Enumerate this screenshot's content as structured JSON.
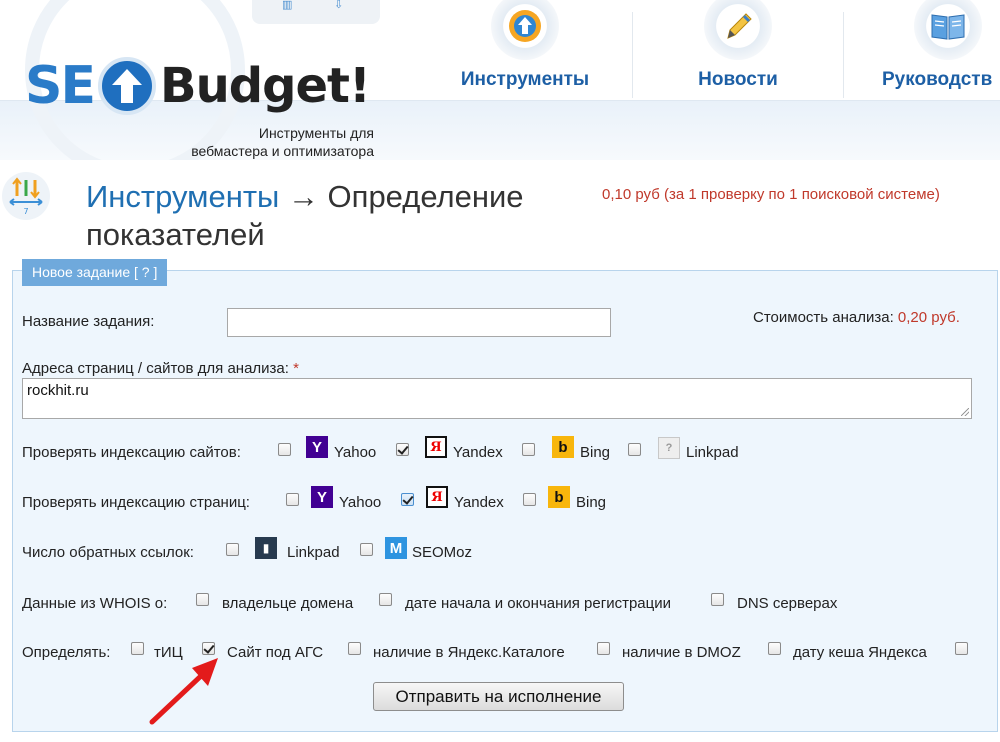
{
  "header": {
    "logo": {
      "se": "SE",
      "budget": "Budget!"
    },
    "tagline_line1": "Инструменты для",
    "tagline_line2": "вебмастера и оптимизатора",
    "nav": [
      {
        "label": "Инструменты",
        "icon": "upload-target-icon"
      },
      {
        "label": "Новости",
        "icon": "pencil-icon"
      },
      {
        "label": "Руководств",
        "icon": "book-icon"
      }
    ]
  },
  "page": {
    "title_link": "Инструменты",
    "title_arrow": "→",
    "title_rest": "Определение показателей",
    "price_note": "0,10 руб (за 1 проверку по 1 поисковой системе)"
  },
  "form": {
    "tab_label": "Новое задание [ ? ]",
    "task_name_label": "Название задания:",
    "task_name_value": "",
    "cost_label": "Стоимость анализа:",
    "cost_value": "0,20 руб.",
    "urls_label": "Адреса страниц / сайтов для анализа:",
    "required_mark": "*",
    "urls_value": "rockhit.ru",
    "site_index": {
      "label": "Проверять индексацию сайтов:",
      "options": [
        {
          "label": "Yahoo",
          "checked": false,
          "icon": "yahoo-icon"
        },
        {
          "label": "Yandex",
          "checked": true,
          "icon": "yandex-icon"
        },
        {
          "label": "Bing",
          "checked": false,
          "icon": "bing-icon"
        },
        {
          "label": "Linkpad",
          "checked": false,
          "icon": "linkpad-icon"
        }
      ]
    },
    "page_index": {
      "label": "Проверять индексацию страниц:",
      "options": [
        {
          "label": "Yahoo",
          "checked": false,
          "icon": "yahoo-icon"
        },
        {
          "label": "Yandex",
          "checked": true,
          "icon": "yandex-icon"
        },
        {
          "label": "Bing",
          "checked": false,
          "icon": "bing-icon"
        }
      ]
    },
    "backlinks": {
      "label": "Число обратных ссылок:",
      "options": [
        {
          "label": "Linkpad",
          "checked": false,
          "icon": "linkpad-icon"
        },
        {
          "label": "SEOMoz",
          "checked": false,
          "icon": "seomoz-icon"
        }
      ]
    },
    "whois": {
      "label": "Данные из WHOIS о:",
      "options": [
        {
          "label": "владельце домена",
          "checked": false
        },
        {
          "label": "дате начала и окончания регистрации",
          "checked": false
        },
        {
          "label": "DNS серверах",
          "checked": false
        }
      ]
    },
    "detect": {
      "label": "Определять:",
      "options": [
        {
          "label": "тИЦ",
          "checked": false
        },
        {
          "label": "Сайт под АГС",
          "checked": true
        },
        {
          "label": "наличие в Яндекс.Каталоге",
          "checked": false
        },
        {
          "label": "наличие в DMOZ",
          "checked": false
        },
        {
          "label": "дату кеша Яндекса",
          "checked": false
        }
      ],
      "trailing_checkbox_checked": false
    },
    "submit_label": "Отправить на исполнение"
  },
  "colors": {
    "accent_blue": "#1f6fb2",
    "price_red": "#c0392b",
    "panel_bg": "#eef6fd",
    "tab_bg": "#6fa9dc",
    "annotation_arrow": "#e31b1b"
  }
}
